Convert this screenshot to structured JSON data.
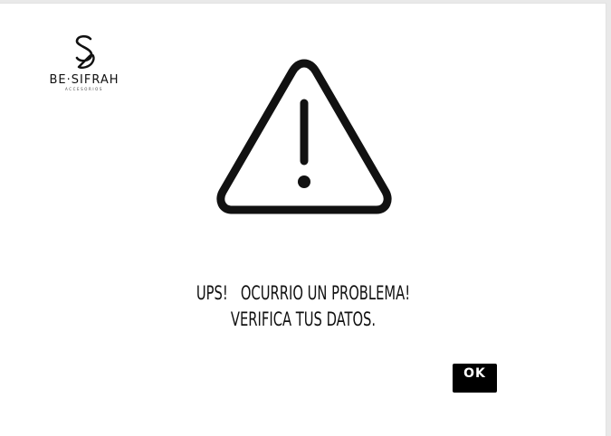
{
  "logo": {
    "name": "BE·SIFRAH",
    "subtitle": "ACCESORIOS"
  },
  "icon": "warning-triangle-icon",
  "message": {
    "line1": "UPS!   OCURRIO UN PROBLEMA!",
    "line2": "VERIFICA TUS DATOS."
  },
  "ok_label": "OK",
  "colors": {
    "background": "#ffffff",
    "text": "#111111",
    "button": "#000000",
    "button_text": "#ffffff"
  }
}
